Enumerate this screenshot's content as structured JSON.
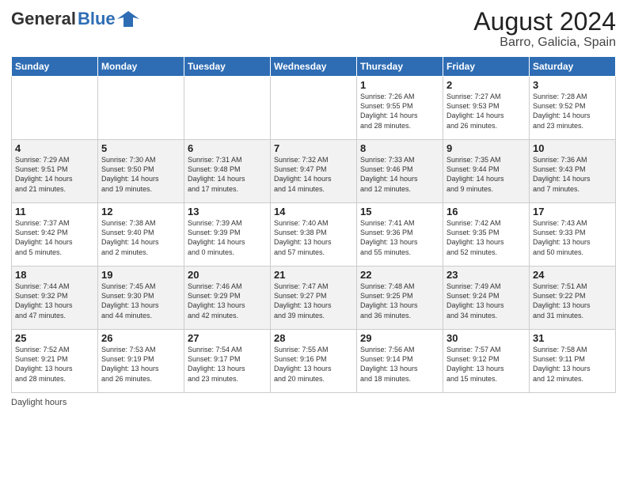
{
  "header": {
    "logo_general": "General",
    "logo_blue": "Blue",
    "title": "August 2024",
    "subtitle": "Barro, Galicia, Spain"
  },
  "days_of_week": [
    "Sunday",
    "Monday",
    "Tuesday",
    "Wednesday",
    "Thursday",
    "Friday",
    "Saturday"
  ],
  "weeks": [
    [
      {
        "day": "",
        "info": ""
      },
      {
        "day": "",
        "info": ""
      },
      {
        "day": "",
        "info": ""
      },
      {
        "day": "",
        "info": ""
      },
      {
        "day": "1",
        "info": "Sunrise: 7:26 AM\nSunset: 9:55 PM\nDaylight: 14 hours\nand 28 minutes."
      },
      {
        "day": "2",
        "info": "Sunrise: 7:27 AM\nSunset: 9:53 PM\nDaylight: 14 hours\nand 26 minutes."
      },
      {
        "day": "3",
        "info": "Sunrise: 7:28 AM\nSunset: 9:52 PM\nDaylight: 14 hours\nand 23 minutes."
      }
    ],
    [
      {
        "day": "4",
        "info": "Sunrise: 7:29 AM\nSunset: 9:51 PM\nDaylight: 14 hours\nand 21 minutes."
      },
      {
        "day": "5",
        "info": "Sunrise: 7:30 AM\nSunset: 9:50 PM\nDaylight: 14 hours\nand 19 minutes."
      },
      {
        "day": "6",
        "info": "Sunrise: 7:31 AM\nSunset: 9:48 PM\nDaylight: 14 hours\nand 17 minutes."
      },
      {
        "day": "7",
        "info": "Sunrise: 7:32 AM\nSunset: 9:47 PM\nDaylight: 14 hours\nand 14 minutes."
      },
      {
        "day": "8",
        "info": "Sunrise: 7:33 AM\nSunset: 9:46 PM\nDaylight: 14 hours\nand 12 minutes."
      },
      {
        "day": "9",
        "info": "Sunrise: 7:35 AM\nSunset: 9:44 PM\nDaylight: 14 hours\nand 9 minutes."
      },
      {
        "day": "10",
        "info": "Sunrise: 7:36 AM\nSunset: 9:43 PM\nDaylight: 14 hours\nand 7 minutes."
      }
    ],
    [
      {
        "day": "11",
        "info": "Sunrise: 7:37 AM\nSunset: 9:42 PM\nDaylight: 14 hours\nand 5 minutes."
      },
      {
        "day": "12",
        "info": "Sunrise: 7:38 AM\nSunset: 9:40 PM\nDaylight: 14 hours\nand 2 minutes."
      },
      {
        "day": "13",
        "info": "Sunrise: 7:39 AM\nSunset: 9:39 PM\nDaylight: 14 hours\nand 0 minutes."
      },
      {
        "day": "14",
        "info": "Sunrise: 7:40 AM\nSunset: 9:38 PM\nDaylight: 13 hours\nand 57 minutes."
      },
      {
        "day": "15",
        "info": "Sunrise: 7:41 AM\nSunset: 9:36 PM\nDaylight: 13 hours\nand 55 minutes."
      },
      {
        "day": "16",
        "info": "Sunrise: 7:42 AM\nSunset: 9:35 PM\nDaylight: 13 hours\nand 52 minutes."
      },
      {
        "day": "17",
        "info": "Sunrise: 7:43 AM\nSunset: 9:33 PM\nDaylight: 13 hours\nand 50 minutes."
      }
    ],
    [
      {
        "day": "18",
        "info": "Sunrise: 7:44 AM\nSunset: 9:32 PM\nDaylight: 13 hours\nand 47 minutes."
      },
      {
        "day": "19",
        "info": "Sunrise: 7:45 AM\nSunset: 9:30 PM\nDaylight: 13 hours\nand 44 minutes."
      },
      {
        "day": "20",
        "info": "Sunrise: 7:46 AM\nSunset: 9:29 PM\nDaylight: 13 hours\nand 42 minutes."
      },
      {
        "day": "21",
        "info": "Sunrise: 7:47 AM\nSunset: 9:27 PM\nDaylight: 13 hours\nand 39 minutes."
      },
      {
        "day": "22",
        "info": "Sunrise: 7:48 AM\nSunset: 9:25 PM\nDaylight: 13 hours\nand 36 minutes."
      },
      {
        "day": "23",
        "info": "Sunrise: 7:49 AM\nSunset: 9:24 PM\nDaylight: 13 hours\nand 34 minutes."
      },
      {
        "day": "24",
        "info": "Sunrise: 7:51 AM\nSunset: 9:22 PM\nDaylight: 13 hours\nand 31 minutes."
      }
    ],
    [
      {
        "day": "25",
        "info": "Sunrise: 7:52 AM\nSunset: 9:21 PM\nDaylight: 13 hours\nand 28 minutes."
      },
      {
        "day": "26",
        "info": "Sunrise: 7:53 AM\nSunset: 9:19 PM\nDaylight: 13 hours\nand 26 minutes."
      },
      {
        "day": "27",
        "info": "Sunrise: 7:54 AM\nSunset: 9:17 PM\nDaylight: 13 hours\nand 23 minutes."
      },
      {
        "day": "28",
        "info": "Sunrise: 7:55 AM\nSunset: 9:16 PM\nDaylight: 13 hours\nand 20 minutes."
      },
      {
        "day": "29",
        "info": "Sunrise: 7:56 AM\nSunset: 9:14 PM\nDaylight: 13 hours\nand 18 minutes."
      },
      {
        "day": "30",
        "info": "Sunrise: 7:57 AM\nSunset: 9:12 PM\nDaylight: 13 hours\nand 15 minutes."
      },
      {
        "day": "31",
        "info": "Sunrise: 7:58 AM\nSunset: 9:11 PM\nDaylight: 13 hours\nand 12 minutes."
      }
    ]
  ],
  "footer": {
    "daylight_label": "Daylight hours"
  }
}
